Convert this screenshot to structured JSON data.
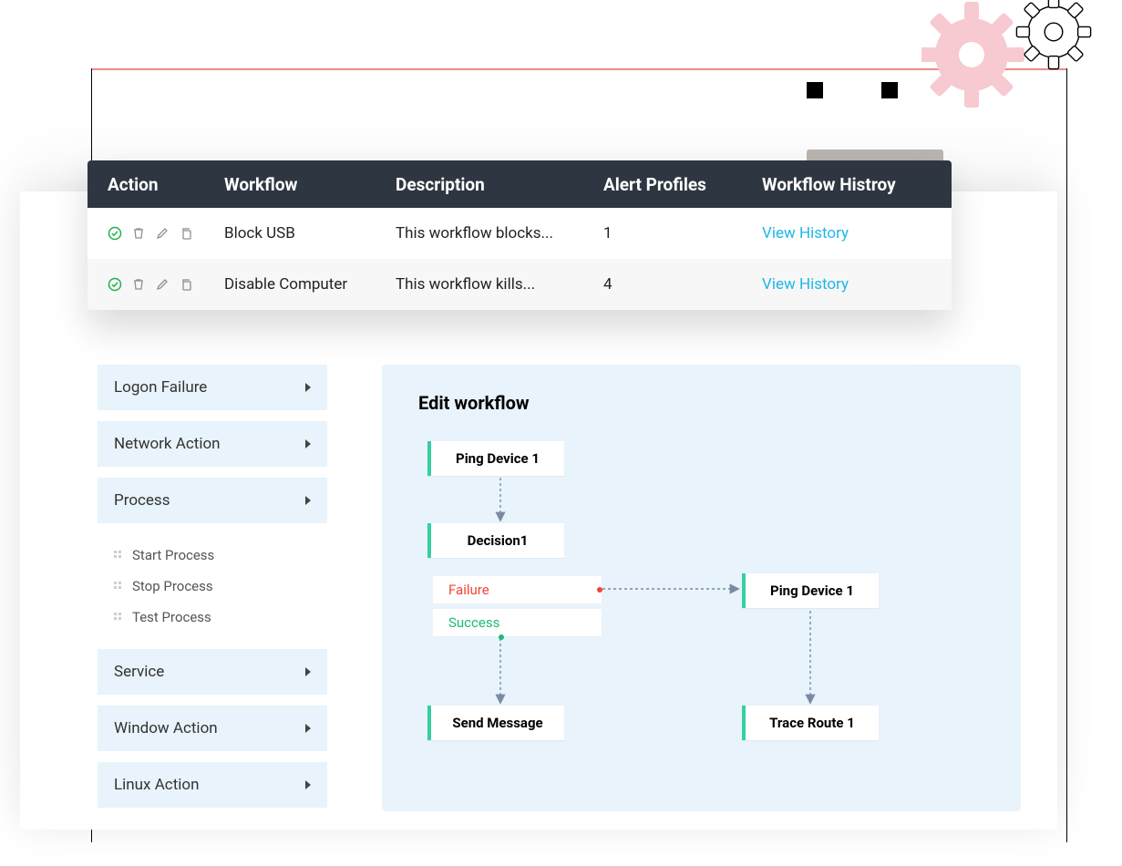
{
  "table": {
    "headers": {
      "action": "Action",
      "workflow": "Workflow",
      "description": "Description",
      "alert": "Alert Profiles",
      "history": "Workflow Histroy"
    },
    "rows": [
      {
        "workflow": "Block USB",
        "description": "This workflow blocks...",
        "alert": "1",
        "history": "View History"
      },
      {
        "workflow": "Disable Computer",
        "description": "This workflow kills...",
        "alert": "4",
        "history": "View History"
      }
    ]
  },
  "sidebar": {
    "items": [
      {
        "label": "Logon Failure"
      },
      {
        "label": "Network Action"
      },
      {
        "label": "Process"
      },
      {
        "label": "Service"
      },
      {
        "label": "Window Action"
      },
      {
        "label": "Linux Action"
      }
    ],
    "process_sub": [
      {
        "label": "Start Process"
      },
      {
        "label": "Stop Process"
      },
      {
        "label": "Test Process"
      }
    ]
  },
  "editor": {
    "title": "Edit workflow",
    "nodes": {
      "n1": "Ping Device 1",
      "n2": "Decision1",
      "n3_fail": "Failure",
      "n3_succ": "Success",
      "n4": "Send Message",
      "n5": "Ping Device 1",
      "n6": "Trace Route 1"
    }
  },
  "colors": {
    "header_bg": "#2e3641",
    "panel_bg": "#e8f3fb",
    "link": "#1fb6e8",
    "accent_green": "#35d0a0",
    "failure": "#f44336",
    "success": "#1db97a",
    "gear_pink": "#f7c9d1"
  }
}
